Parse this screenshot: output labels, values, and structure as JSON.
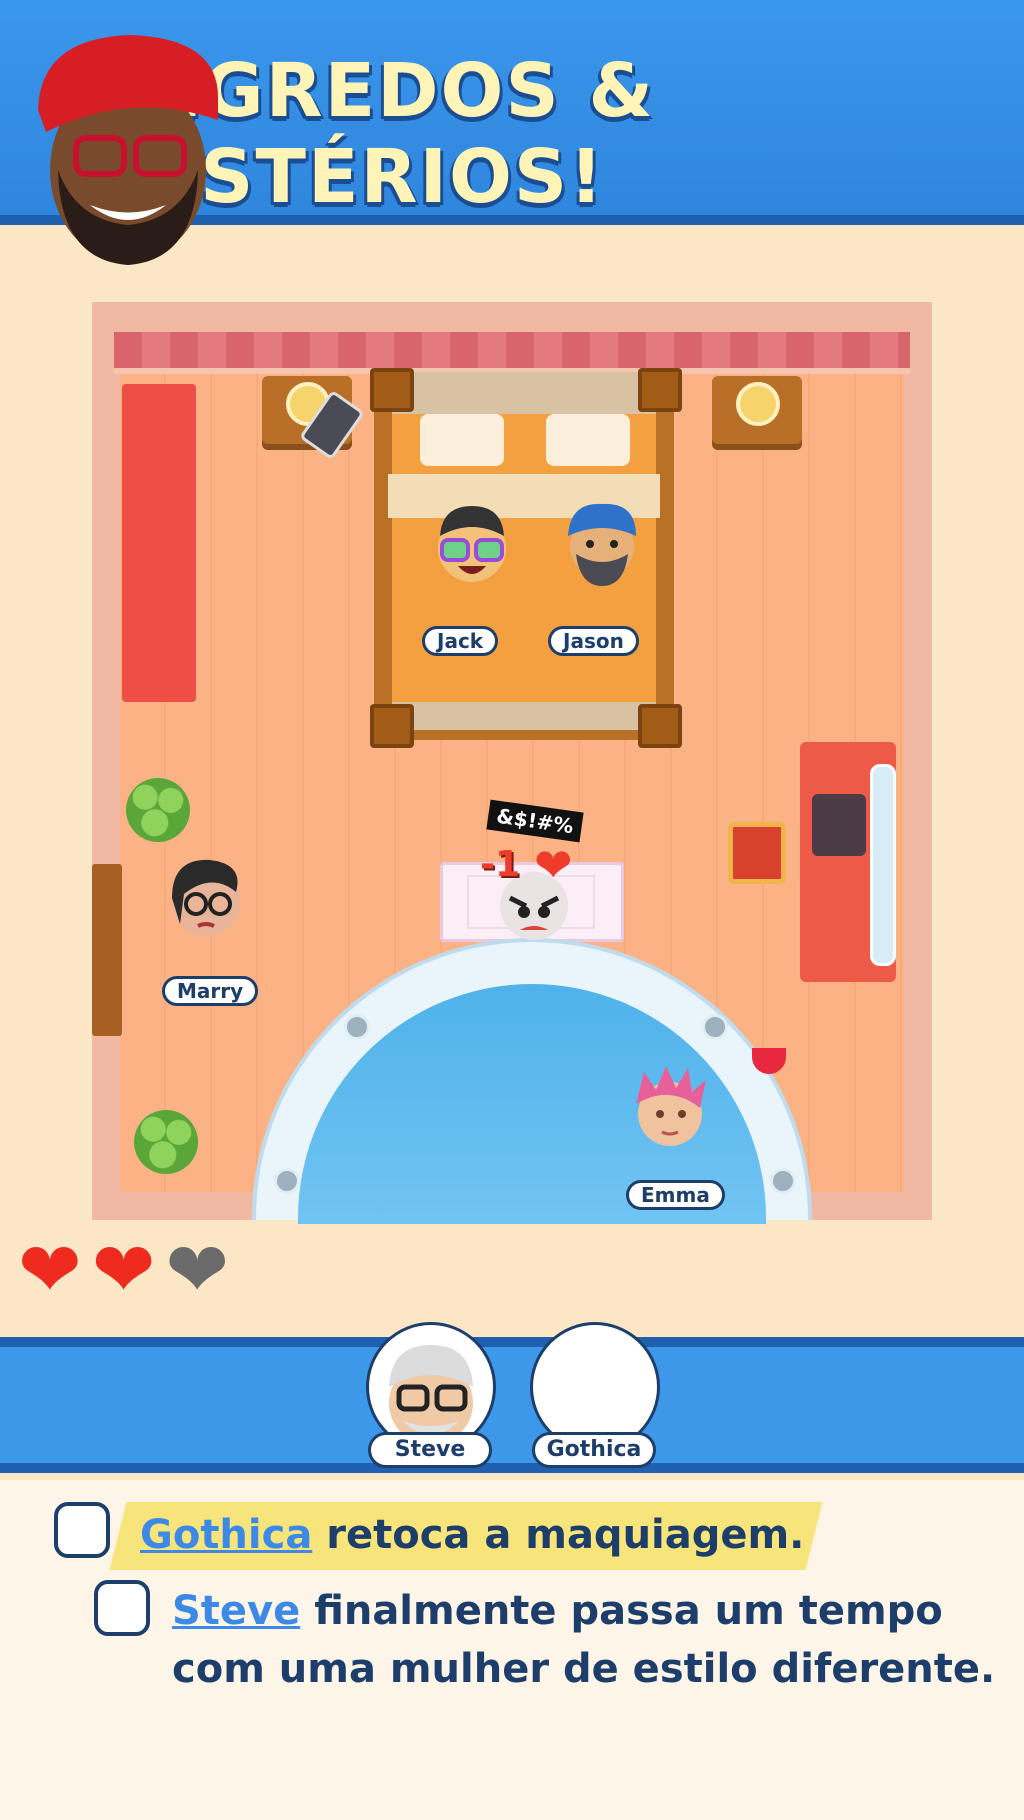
{
  "banner": {
    "title": "SEGREDOS & MISTÉRIOS!"
  },
  "room": {
    "characters": {
      "jack": "Jack",
      "jason": "Jason",
      "marry": "Marry",
      "emma": "Emma"
    },
    "angry_text": "&$!#%",
    "penalty": "-1"
  },
  "lives": {
    "full": 2,
    "total": 3
  },
  "suspects": [
    {
      "name": "Steve"
    },
    {
      "name": "Gothica"
    }
  ],
  "tasks": [
    {
      "subject": "Gothica",
      "text": " retoca a maquiagem."
    },
    {
      "subject": "Steve",
      "text": " finalmente passa um tempo",
      "text_line2": "com uma mulher de estilo diferente."
    }
  ],
  "colors": {
    "banner": "#3b97ec",
    "accent_name": "#3d8ae6",
    "heart_full": "#ef2a1f",
    "heart_empty": "#6b6b6b",
    "highlight": "#f7e47a"
  }
}
